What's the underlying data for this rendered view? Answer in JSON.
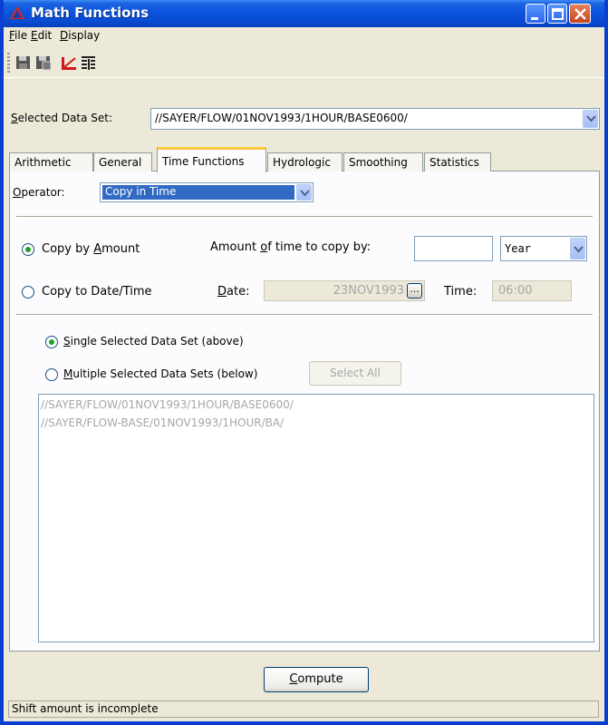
{
  "window": {
    "title": "Math Functions"
  },
  "menu": [
    "File",
    "Edit",
    "Display"
  ],
  "menu_mnemonic": [
    "F",
    "E",
    "D"
  ],
  "toolbar": {
    "icons": [
      "save-icon",
      "save-as-icon",
      "plot-icon",
      "tabulate-icon"
    ]
  },
  "selected_data_set": {
    "label_mn": "S",
    "label_rest": "elected Data Set:",
    "value": "//SAYER/FLOW/01NOV1993/1HOUR/BASE0600/"
  },
  "tabs": [
    "Arithmetic",
    "General",
    "Time Functions",
    "Hydrologic",
    "Smoothing",
    "Statistics"
  ],
  "active_tab": "Time Functions",
  "operator": {
    "label_mn": "O",
    "label_rest": "perator:",
    "value": "Copy in Time"
  },
  "copy_by_amount": {
    "label_pre": "Copy by ",
    "label_mn": "A",
    "label_post": "mount",
    "selected": true
  },
  "amount_label": {
    "pre": "Amount ",
    "mn": "o",
    "post": "f time to copy by:"
  },
  "amount_value": "",
  "unit": "Year",
  "copy_to_date": {
    "label": "Copy to Date/Time",
    "selected": false
  },
  "date": {
    "label_mn": "D",
    "label_rest": "ate:",
    "value": "23NOV1993",
    "button": "..."
  },
  "time": {
    "label": "Time:",
    "value": "06:00"
  },
  "single": {
    "label_mn": "S",
    "label_rest": "ingle Selected Data Set (above)",
    "selected": true
  },
  "multiple": {
    "label_mn": "M",
    "label_rest": "ultiple Selected Data Sets (below)",
    "selected": false
  },
  "select_all": "Select All",
  "data_sets": [
    "//SAYER/FLOW/01NOV1993/1HOUR/BASE0600/",
    "//SAYER/FLOW-BASE/01NOV1993/1HOUR/BA/"
  ],
  "compute": {
    "mn": "C",
    "rest": "ompute"
  },
  "status": "Shift amount is incomplete"
}
